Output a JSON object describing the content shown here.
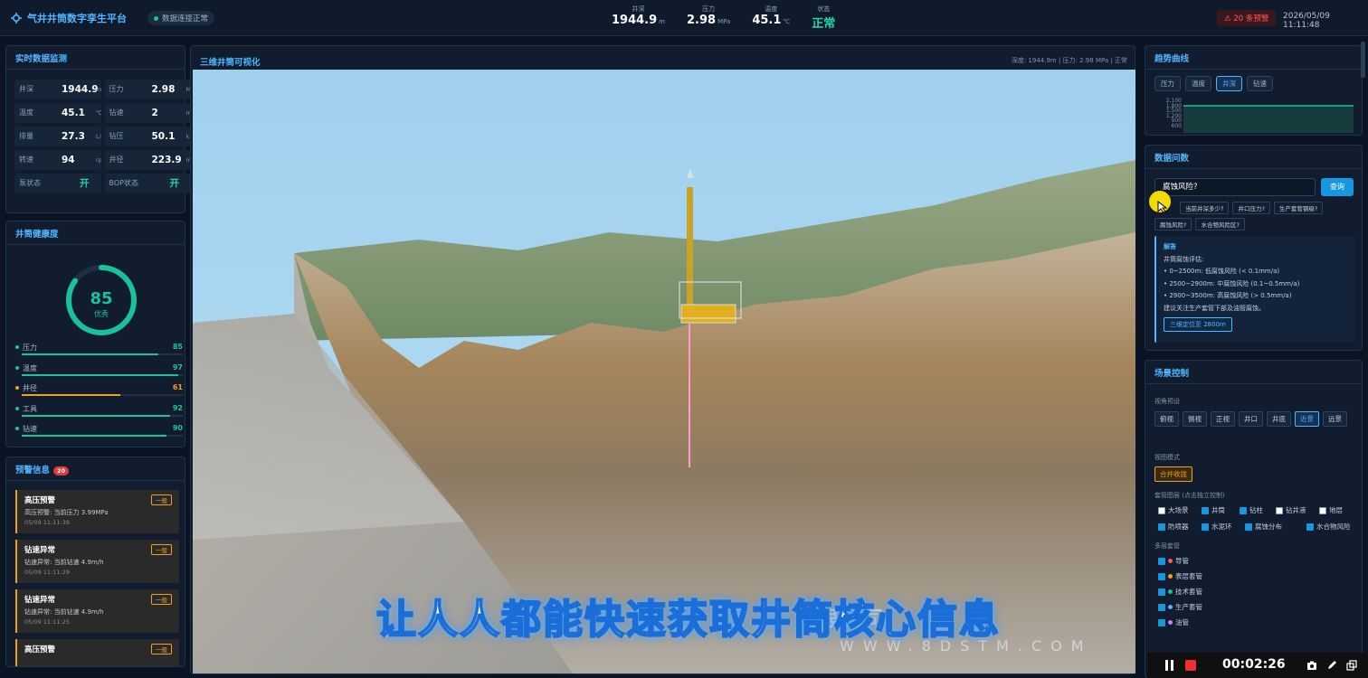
{
  "header": {
    "app_title": "气井井筒数字孪生平台",
    "connection_status": "数据连接正常",
    "metrics": [
      {
        "label": "井深",
        "value": "1944.9",
        "unit": "m"
      },
      {
        "label": "压力",
        "value": "2.98",
        "unit": "MPa"
      },
      {
        "label": "温度",
        "value": "45.1",
        "unit": "℃"
      },
      {
        "label": "状态",
        "value": "正常",
        "unit": ""
      }
    ],
    "alarm_badge": "⚠ 20 条预警",
    "datetime": "2026/05/09 11:11:48"
  },
  "realtime": {
    "title": "实时数据监测",
    "items": [
      {
        "label": "井深",
        "value": "1944.9",
        "unit": "m"
      },
      {
        "label": "压力",
        "value": "2.98",
        "unit": "M"
      },
      {
        "label": "温度",
        "value": "45.1",
        "unit": "℃"
      },
      {
        "label": "钻速",
        "value": "2",
        "unit": "m"
      },
      {
        "label": "排量",
        "value": "27.3",
        "unit": "L/s"
      },
      {
        "label": "钻压",
        "value": "50.1",
        "unit": "k"
      },
      {
        "label": "转速",
        "value": "94",
        "unit": "rpm"
      },
      {
        "label": "井径",
        "value": "223.9",
        "unit": "m"
      },
      {
        "label": "泵状态",
        "value": "开",
        "unit": ""
      },
      {
        "label": "BOP状态",
        "value": "开",
        "unit": ""
      }
    ]
  },
  "health": {
    "title": "井筒健康度",
    "score": "85",
    "score_label": "优秀",
    "score_fraction": 0.85,
    "items": [
      {
        "name": "压力",
        "score": "85",
        "fraction": 0.85,
        "color": "#19c39a"
      },
      {
        "name": "温度",
        "score": "97",
        "fraction": 0.97,
        "color": "#19c39a"
      },
      {
        "name": "井径",
        "score": "61",
        "fraction": 0.61,
        "color": "#f0a020"
      },
      {
        "name": "工具",
        "score": "92",
        "fraction": 0.92,
        "color": "#19c39a"
      },
      {
        "name": "钻速",
        "score": "90",
        "fraction": 0.9,
        "color": "#19c39a"
      }
    ]
  },
  "alerts": {
    "title": "预警信息",
    "count": "20",
    "items": [
      {
        "title": "高压预警",
        "desc": "高压预警: 当前压力 3.99MPa",
        "time": "05/09 11:11:39",
        "level": "一般"
      },
      {
        "title": "钻速异常",
        "desc": "钻速异常: 当前钻速 4.9m/h",
        "time": "05/09 11:11:29",
        "level": "一般"
      },
      {
        "title": "钻速异常",
        "desc": "钻速异常: 当前钻速 4.9m/h",
        "time": "05/09 11:11:25",
        "level": "一般"
      },
      {
        "title": "高压预警",
        "desc": "",
        "time": "",
        "level": "一般"
      }
    ]
  },
  "viewer": {
    "title": "三维井筒可视化",
    "info": "深度: 1944.9m | 压力: 2.98 MPa | 正常",
    "subtitle": "让人人都能快速获取井筒核心信息",
    "watermark_text": "限公司",
    "watermark_url": "WWW.8DSTM.COM"
  },
  "trend": {
    "title": "趋势曲线",
    "tabs": [
      "压力",
      "温度",
      "井深",
      "钻速"
    ],
    "active_tab": 2,
    "y_ticks": [
      "2,100",
      "1,800",
      "1,500",
      "1,200",
      "900",
      "600"
    ]
  },
  "qa": {
    "title": "数据问数",
    "input_value": "腐蚀风险?",
    "button": "查询",
    "chips": [
      "当前井深多少?",
      "井口压力?",
      "生产套管钢级?",
      "腐蚀风险?",
      "水合物风险区?"
    ],
    "answer_title": "解答",
    "answer_lines": [
      "井筒腐蚀评估:",
      "• 0~2500m: 低腐蚀风险 (< 0.1mm/a)",
      "• 2500~2900m: 中腐蚀风险 (0.1~0.5mm/a)",
      "• 2900~3500m: 高腐蚀风险 (> 0.5mm/a)",
      "建议关注生产套管下部及油管腐蚀。"
    ],
    "locate_button": "三维定位至 2800m"
  },
  "scene": {
    "title": "场景控制",
    "view_label": "视角预设",
    "views": [
      "俯视",
      "侧视",
      "正视",
      "井口",
      "井底",
      "近景",
      "远景"
    ],
    "active_view": 5,
    "mode_label": "视图模式",
    "mode_button": "合并收拢",
    "layers_label": "套管图层 (点击独立控制)",
    "layers": [
      {
        "name": "大场景",
        "checked": false
      },
      {
        "name": "井筒",
        "checked": true
      },
      {
        "name": "钻柱",
        "checked": true
      },
      {
        "name": "钻井液",
        "checked": false
      },
      {
        "name": "地层",
        "checked": false
      },
      {
        "name": "防喷器",
        "checked": true
      },
      {
        "name": "水泥环",
        "checked": true
      },
      {
        "name": "腐蚀分布",
        "checked": true
      },
      {
        "name": "水合物风险",
        "checked": true
      }
    ],
    "casing_label": "多层套管",
    "casings": [
      {
        "name": "导管",
        "color": "#ff5a5a"
      },
      {
        "name": "表层套管",
        "color": "#f0a020"
      },
      {
        "name": "技术套管",
        "color": "#19c39a"
      },
      {
        "name": "生产套管",
        "color": "#4fb6ff"
      },
      {
        "name": "油管",
        "color": "#c77dff"
      }
    ]
  },
  "recorder": {
    "timer": "00:02:26"
  }
}
